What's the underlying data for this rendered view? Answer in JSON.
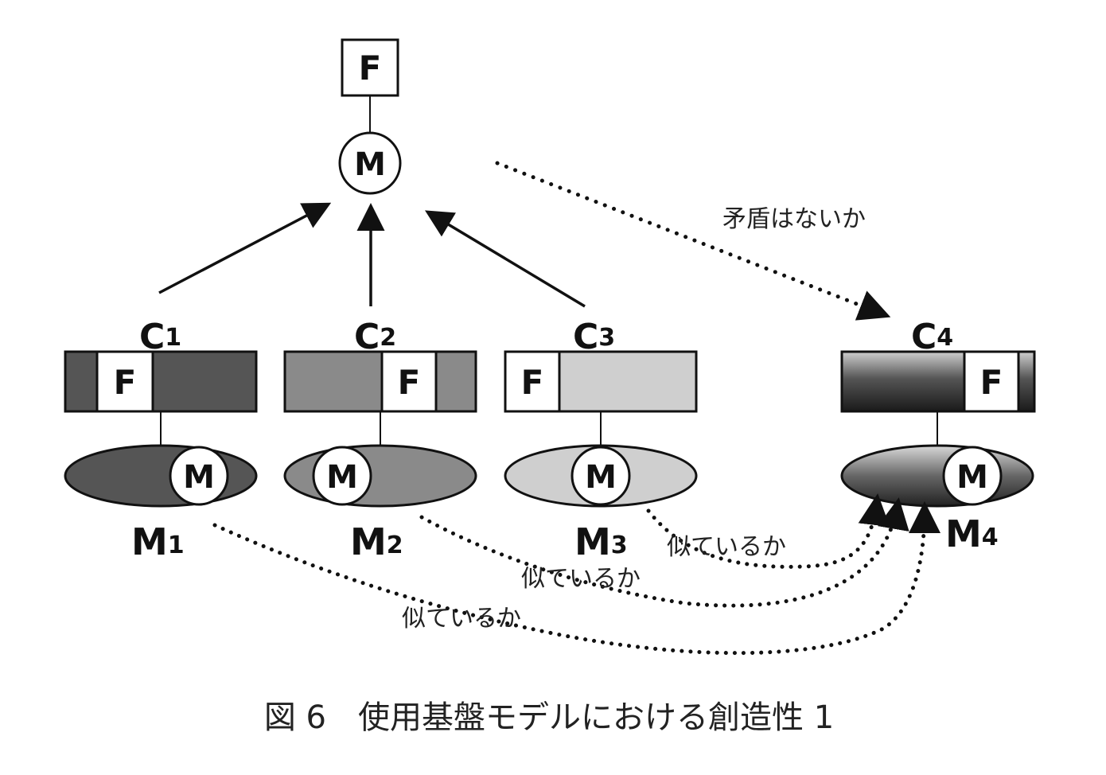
{
  "top": {
    "form_label": "F",
    "meaning_label": "M"
  },
  "constructions": [
    {
      "id": "C",
      "sub": "1",
      "form": "F",
      "meaning": "M",
      "m_id": "M",
      "m_sub": "1",
      "color": "#555555"
    },
    {
      "id": "C",
      "sub": "2",
      "form": "F",
      "meaning": "M",
      "m_id": "M",
      "m_sub": "2",
      "color": "#8a8a8a"
    },
    {
      "id": "C",
      "sub": "3",
      "form": "F",
      "meaning": "M",
      "m_id": "M",
      "m_sub": "3",
      "color": "#cfcfcf"
    },
    {
      "id": "C",
      "sub": "4",
      "form": "F",
      "meaning": "M",
      "m_id": "M",
      "m_sub": "4",
      "color": "#3a3a3a"
    }
  ],
  "annotations": {
    "contradiction": "矛盾はないか",
    "similar_1": "似ているか",
    "similar_2": "似ているか",
    "similar_3": "似ているか"
  },
  "caption": "図 6　使用基盤モデルにおける創造性 1"
}
